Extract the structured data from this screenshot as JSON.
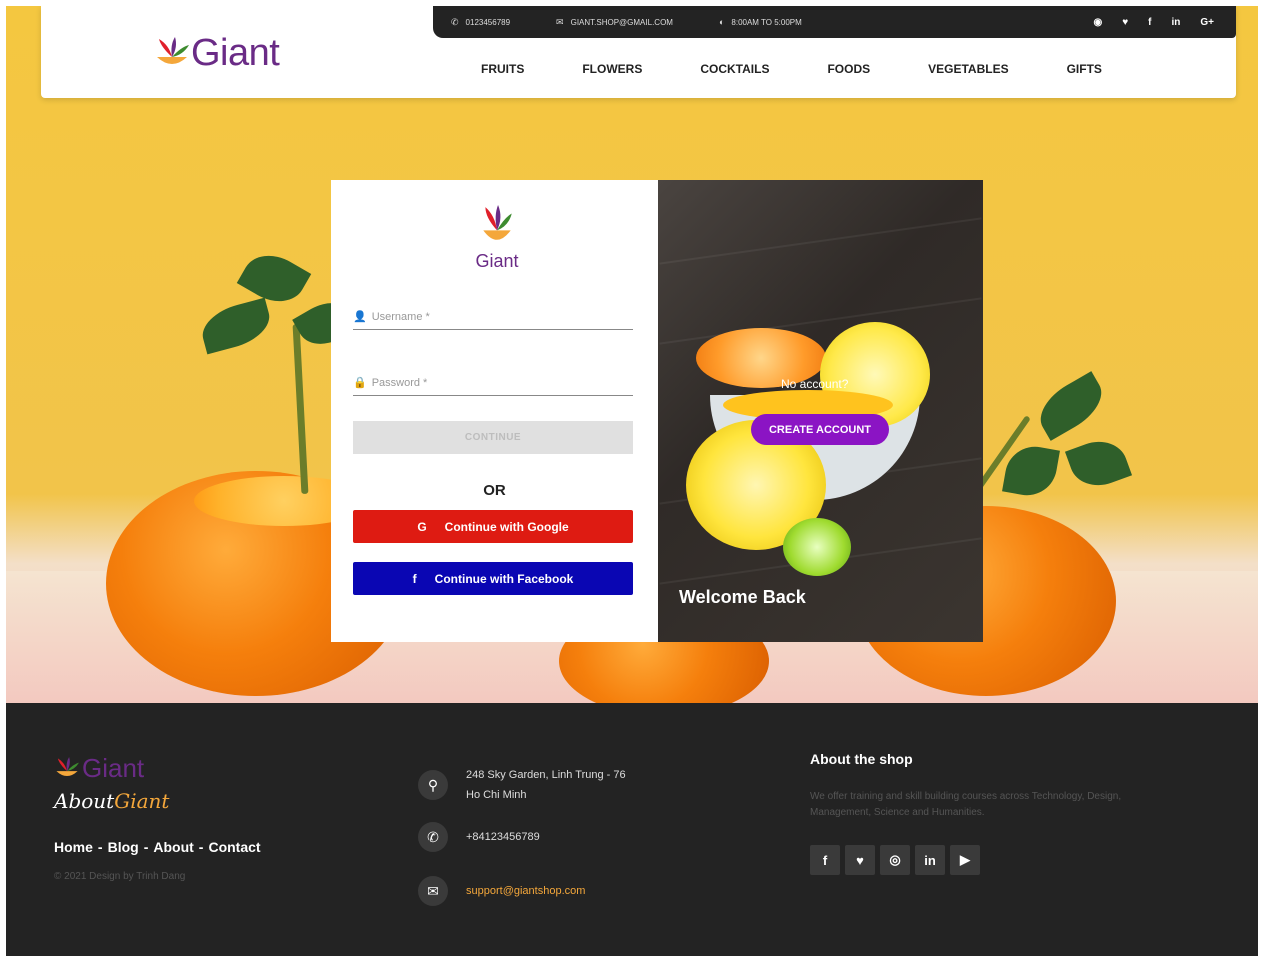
{
  "colors": {
    "brand": "#6a2b86",
    "accent": "#f4a73b",
    "google": "#de1b12",
    "facebook": "#0a06b3",
    "create": "#8b14c4",
    "footer_bg": "#232323"
  },
  "topbar": {
    "phone": "0123456789",
    "email": "GIANT.SHOP@GMAIL.COM",
    "hours": "8:00AM TO 5:00PM",
    "social_icons": [
      "globe-icon",
      "twitter-icon",
      "facebook-icon",
      "linkedin-icon",
      "google-plus-icon"
    ]
  },
  "header": {
    "brand": "Giant",
    "nav": [
      "FRUITS",
      "FLOWERS",
      "COCKTAILS",
      "FOODS",
      "VEGETABLES",
      "GIFTS"
    ]
  },
  "login": {
    "brand": "Giant",
    "username_placeholder": "Username *",
    "password_placeholder": "Password *",
    "continue_label": "CONTINUE",
    "or_label": "OR",
    "google_label": "Continue with Google",
    "facebook_label": "Continue with Facebook"
  },
  "panel": {
    "no_account": "No account?",
    "create_label": "CREATE ACCOUNT",
    "welcome": "Welcome Back"
  },
  "footer": {
    "brand": "Giant",
    "about_prefix": "About",
    "about_accent": "Giant",
    "links": [
      "Home",
      "Blog",
      "About",
      "Contact"
    ],
    "copyright": "© 2021 Design by Trinh Dang",
    "address_line1": "248 Sky Garden, Linh Trung - 76",
    "address_line2": "Ho Chi Minh",
    "phone": "+84123456789",
    "email": "support@giantshop.com",
    "about_heading": "About the shop",
    "about_text": "We offer training and skill building courses across Technology, Design, Management, Science and Humanities.",
    "social_icons": [
      "facebook-icon",
      "twitter-icon",
      "instagram-icon",
      "linkedin-icon",
      "youtube-icon"
    ]
  }
}
